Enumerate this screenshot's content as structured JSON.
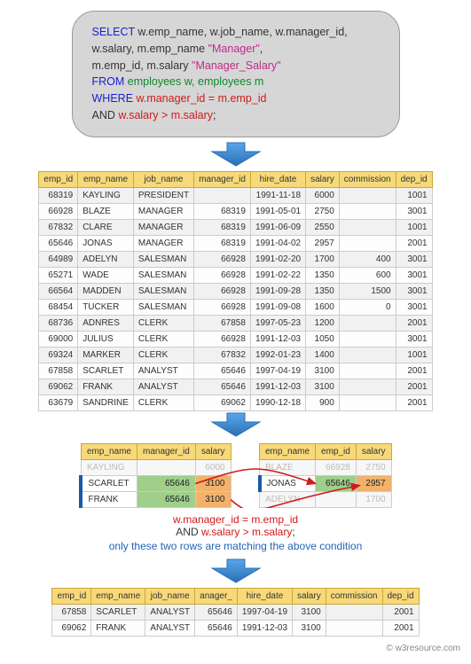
{
  "sql": {
    "l1a": "SELECT",
    "l1b": " w.emp_name, w.job_name, w.manager_id,",
    "l2a": "w.salary, m.emp_name ",
    "l2b": "\"Manager\"",
    "l2c": ",",
    "l3a": "m.emp_id, m.salary ",
    "l3b": "\"Manager_Salary\"",
    "l4a": "FROM",
    "l4b": " employees w, employees m",
    "l5a": "WHERE",
    "l5b": " w.manager_id = m.emp_id",
    "l6a": " AND",
    "l6b": " w.salary > m.salary",
    "l6c": ";"
  },
  "chart_data": {
    "type": "table",
    "main_table": {
      "columns": [
        "emp_id",
        "emp_name",
        "job_name",
        "manager_id",
        "hire_date",
        "salary",
        "commission",
        "dep_id"
      ],
      "rows": [
        [
          68319,
          "KAYLING",
          "PRESIDENT",
          "",
          "1991-11-18",
          6000,
          "",
          1001
        ],
        [
          66928,
          "BLAZE",
          "MANAGER",
          68319,
          "1991-05-01",
          2750,
          "",
          3001
        ],
        [
          67832,
          "CLARE",
          "MANAGER",
          68319,
          "1991-06-09",
          2550,
          "",
          1001
        ],
        [
          65646,
          "JONAS",
          "MANAGER",
          68319,
          "1991-04-02",
          2957,
          "",
          2001
        ],
        [
          64989,
          "ADELYN",
          "SALESMAN",
          66928,
          "1991-02-20",
          1700,
          400,
          3001
        ],
        [
          65271,
          "WADE",
          "SALESMAN",
          66928,
          "1991-02-22",
          1350,
          600,
          3001
        ],
        [
          66564,
          "MADDEN",
          "SALESMAN",
          66928,
          "1991-09-28",
          1350,
          1500,
          3001
        ],
        [
          68454,
          "TUCKER",
          "SALESMAN",
          66928,
          "1991-09-08",
          1600,
          0,
          3001
        ],
        [
          68736,
          "ADNRES",
          "CLERK",
          67858,
          "1997-05-23",
          1200,
          "",
          2001
        ],
        [
          69000,
          "JULIUS",
          "CLERK",
          66928,
          "1991-12-03",
          1050,
          "",
          3001
        ],
        [
          69324,
          "MARKER",
          "CLERK",
          67832,
          "1992-01-23",
          1400,
          "",
          1001
        ],
        [
          67858,
          "SCARLET",
          "ANALYST",
          65646,
          "1997-04-19",
          3100,
          "",
          2001
        ],
        [
          69062,
          "FRANK",
          "ANALYST",
          65646,
          "1991-12-03",
          3100,
          "",
          2001
        ],
        [
          63679,
          "SANDRINE",
          "CLERK",
          69062,
          "1990-12-18",
          900,
          "",
          2001
        ]
      ]
    },
    "left_mini": {
      "columns": [
        "emp_name",
        "manager_id",
        "salary"
      ],
      "dim0": [
        "KAYLING",
        "",
        "6000"
      ],
      "row1": [
        "SCARLET",
        65646,
        3100
      ],
      "row2": [
        "FRANK",
        65646,
        3100
      ]
    },
    "right_mini": {
      "columns": [
        "emp_name",
        "emp_id",
        "salary"
      ],
      "dim0": [
        "BLAZE",
        "66928",
        "2750"
      ],
      "row1": [
        "JONAS",
        65646,
        2957
      ],
      "dim2": [
        "ADELYN",
        "",
        "1700"
      ]
    },
    "result_table": {
      "columns": [
        "emp_id",
        "emp_name",
        "job_name",
        "anager_",
        "hire_date",
        "salary",
        "commission",
        "dep_id"
      ],
      "rows": [
        [
          67858,
          "SCARLET",
          "ANALYST",
          65646,
          "1997-04-19",
          3100,
          "",
          2001
        ],
        [
          69062,
          "FRANK",
          "ANALYST",
          65646,
          "1991-12-03",
          3100,
          "",
          2001
        ]
      ]
    }
  },
  "midcond": {
    "a": "w.manager_id = m.emp_id",
    "and": "AND ",
    "b": "w.salary > m.salary",
    "c": ";"
  },
  "caption": "only these two rows are matching the above condition",
  "footer": "© w3resource.com"
}
